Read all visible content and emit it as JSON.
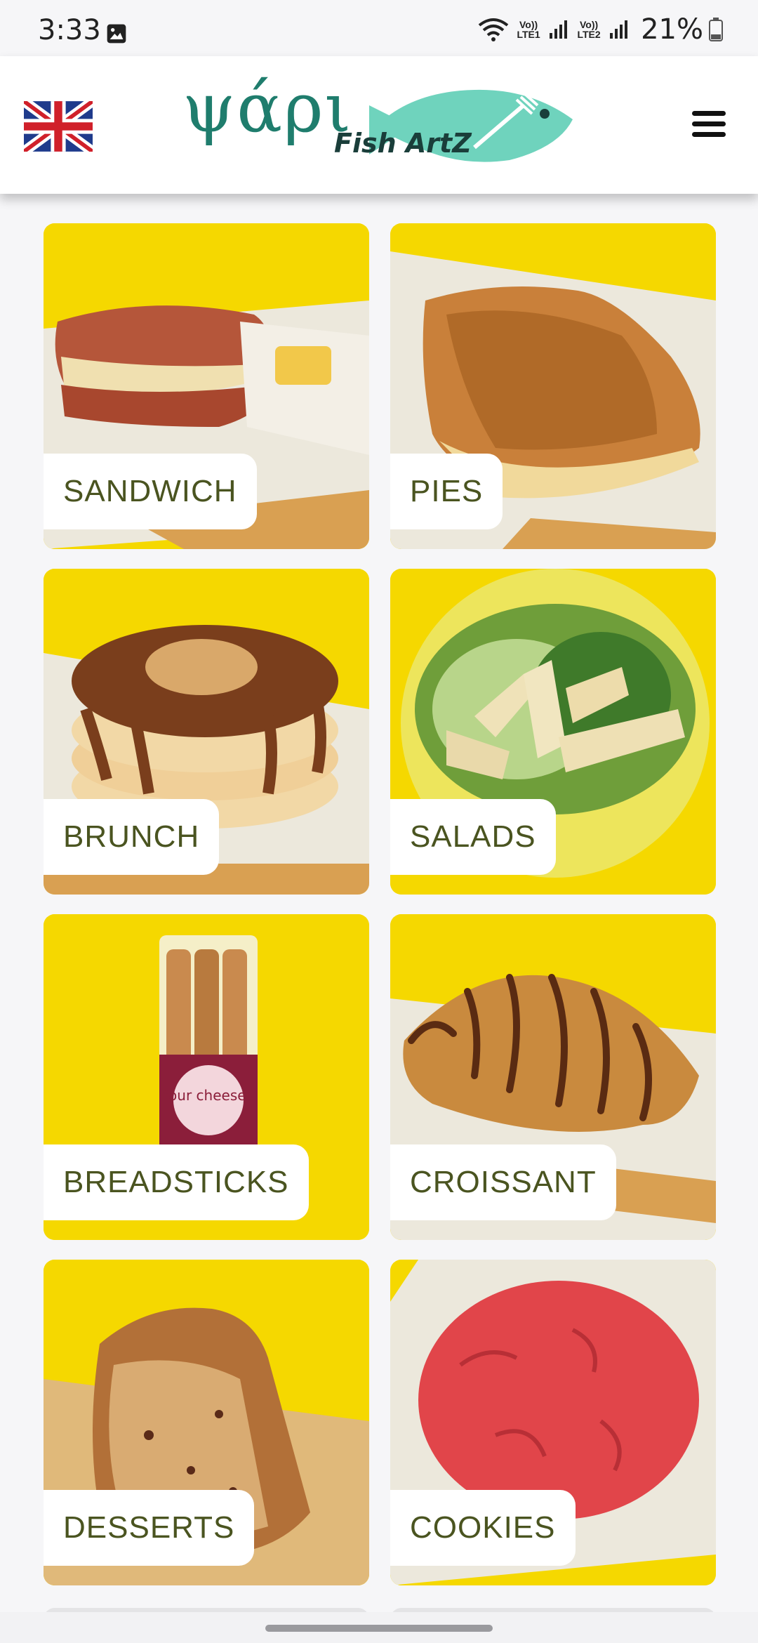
{
  "status_bar": {
    "time": "3:33",
    "sim1": "Vo)) LTE1",
    "sim2": "Vo)) LTE2",
    "battery": "21%"
  },
  "header": {
    "language_icon": "uk-flag-icon",
    "logo_text": "ψάρι",
    "logo_subtext": "Fish ArtZ",
    "menu_icon": "hamburger-menu-icon"
  },
  "categories": [
    {
      "label": "SANDWICH",
      "image": "sandwich-photo"
    },
    {
      "label": "PIES",
      "image": "pie-photo"
    },
    {
      "label": "BRUNCH",
      "image": "pancakes-photo"
    },
    {
      "label": "SALADS",
      "image": "salad-photo"
    },
    {
      "label": "BREADSTICKS",
      "image": "breadsticks-photo",
      "package_text": "four cheeses"
    },
    {
      "label": "CROISSANT",
      "image": "croissant-photo"
    },
    {
      "label": "DESSERTS",
      "image": "cake-photo"
    },
    {
      "label": "COOKIES",
      "image": "cookie-photo"
    }
  ],
  "colors": {
    "card_background": "#f5d800",
    "label_text": "#4a5420",
    "logo_teal": "#6fd3bd"
  }
}
